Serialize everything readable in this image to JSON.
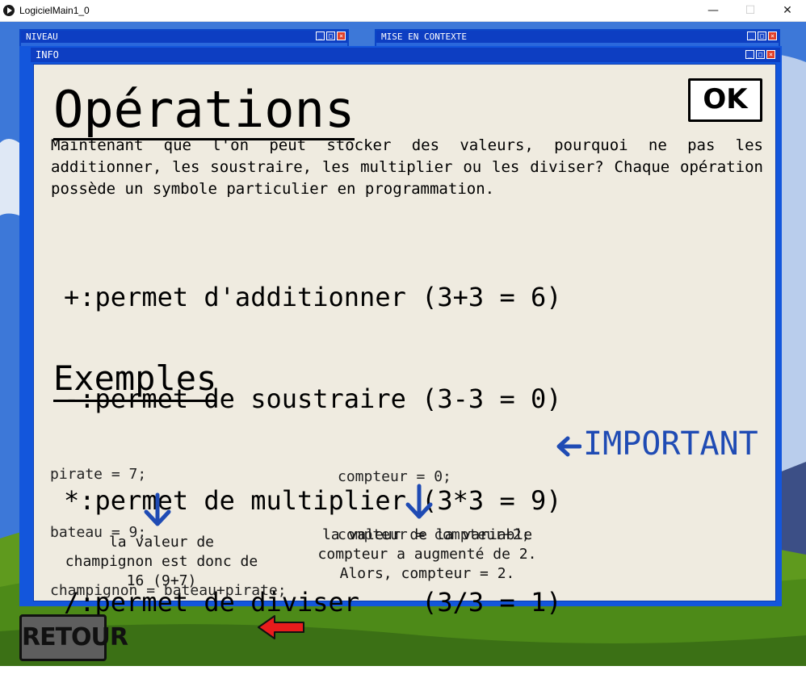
{
  "window": {
    "title": "LogicielMain1_0",
    "minimize": "—",
    "maximize": "☐",
    "close": "✕"
  },
  "bg_windows": [
    {
      "title": "NIVEAU"
    },
    {
      "title": "MISE EN CONTEXTE"
    }
  ],
  "info": {
    "title": "INFO",
    "heading": "Opérations",
    "ok_label": "OK",
    "intro": "Maintenant que l'on peut stocker des valeurs, pourquoi ne pas les additionner, les soustraire, les multiplier ou les diviser? Chaque opération possède un symbole particulier en programmation.",
    "operations": [
      "+:permet d'additionner (3+3 = 6)",
      "-:permet de soustraire (3-3 = 0)",
      "*:permet de multiplier (3*3 = 9)",
      "/:permet de diviser    (3/3 = 1)"
    ],
    "examples_heading": "Exemples",
    "example1_code": [
      "pirate = 7;",
      "bateau = 9;",
      "champignon = bateau+pirate;"
    ],
    "example2_code": [
      "compteur = 0;",
      "compteur = compteur+2;"
    ],
    "important_label": "IMPORTANT",
    "caption1": [
      "la valeur de",
      "champignon est donc de",
      "16 (9+7)"
    ],
    "caption2": [
      "la valeur de la variable",
      "compteur a augmenté de 2.",
      "Alors, compteur = 2."
    ]
  },
  "retour_label": "RETOUR",
  "icons": {
    "app": "play-icon",
    "important_arrow": "arrow-left-icon",
    "down_arrows": "arrow-down-icon",
    "back_arrow": "red-arrow-left-icon"
  },
  "colors": {
    "window_blue": "#1356dc",
    "panel_bg": "#efebe0",
    "accent_blue": "#1f4bb4",
    "arrow_red": "#e81c1c"
  }
}
